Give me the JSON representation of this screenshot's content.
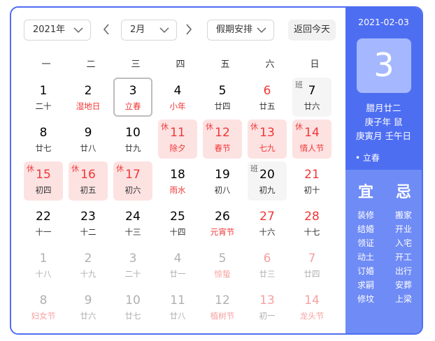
{
  "toolbar": {
    "year": "2021年",
    "month": "2月",
    "holiday": "假期安排",
    "today_button": "返回今天"
  },
  "weekdays": [
    "一",
    "二",
    "三",
    "四",
    "五",
    "六",
    "日"
  ],
  "days": [
    {
      "num": "1",
      "lunar": "二十"
    },
    {
      "num": "2",
      "lunar": "湿地日",
      "lunar_red": true
    },
    {
      "num": "3",
      "lunar": "立春",
      "lunar_red": true,
      "today": true
    },
    {
      "num": "4",
      "lunar": "小年",
      "lunar_red": true
    },
    {
      "num": "5",
      "lunar": "廿四"
    },
    {
      "num": "6",
      "lunar": "廿五",
      "num_red": true
    },
    {
      "num": "7",
      "lunar": "廿六",
      "tag": "班",
      "work": true
    },
    {
      "num": "8",
      "lunar": "廿七"
    },
    {
      "num": "9",
      "lunar": "廿八"
    },
    {
      "num": "10",
      "lunar": "廿九"
    },
    {
      "num": "11",
      "lunar": "除夕",
      "tag": "休",
      "rest": true,
      "num_red": true,
      "lunar_red": true
    },
    {
      "num": "12",
      "lunar": "春节",
      "tag": "休",
      "rest": true,
      "num_red": true,
      "lunar_red": true
    },
    {
      "num": "13",
      "lunar": "七九",
      "tag": "休",
      "rest": true,
      "num_red": true,
      "lunar_red": true
    },
    {
      "num": "14",
      "lunar": "情人节",
      "tag": "休",
      "rest": true,
      "num_red": true,
      "lunar_red": true
    },
    {
      "num": "15",
      "lunar": "初四",
      "tag": "休",
      "rest": true,
      "num_red": true
    },
    {
      "num": "16",
      "lunar": "初五",
      "tag": "休",
      "rest": true,
      "num_red": true
    },
    {
      "num": "17",
      "lunar": "初六",
      "tag": "休",
      "rest": true,
      "num_red": true
    },
    {
      "num": "18",
      "lunar": "雨水",
      "lunar_red": true
    },
    {
      "num": "19",
      "lunar": "初八"
    },
    {
      "num": "20",
      "lunar": "初九",
      "tag": "班",
      "work": true
    },
    {
      "num": "21",
      "lunar": "初十",
      "num_red": true
    },
    {
      "num": "22",
      "lunar": "十一"
    },
    {
      "num": "23",
      "lunar": "十二"
    },
    {
      "num": "24",
      "lunar": "十三"
    },
    {
      "num": "25",
      "lunar": "十四"
    },
    {
      "num": "26",
      "lunar": "元宵节",
      "lunar_red": true
    },
    {
      "num": "27",
      "lunar": "十六",
      "num_red": true
    },
    {
      "num": "28",
      "lunar": "十七",
      "num_red": true
    },
    {
      "num": "1",
      "lunar": "十八",
      "dim": true
    },
    {
      "num": "2",
      "lunar": "十九",
      "dim": true
    },
    {
      "num": "3",
      "lunar": "二十",
      "dim": true
    },
    {
      "num": "4",
      "lunar": "廿一",
      "dim": true
    },
    {
      "num": "5",
      "lunar": "惊蛰",
      "dim": true,
      "lunar_red": true
    },
    {
      "num": "6",
      "lunar": "廿三",
      "dim": true,
      "num_red": true
    },
    {
      "num": "7",
      "lunar": "廿四",
      "dim": true,
      "num_red": true
    },
    {
      "num": "8",
      "lunar": "妇女节",
      "dim": true,
      "lunar_red": true
    },
    {
      "num": "9",
      "lunar": "廿六",
      "dim": true
    },
    {
      "num": "10",
      "lunar": "廿七",
      "dim": true
    },
    {
      "num": "11",
      "lunar": "廿八",
      "dim": true
    },
    {
      "num": "12",
      "lunar": "植树节",
      "dim": true,
      "lunar_red": true
    },
    {
      "num": "13",
      "lunar": "初一",
      "dim": true,
      "num_red": true
    },
    {
      "num": "14",
      "lunar": "龙头节",
      "dim": true,
      "num_red": true,
      "lunar_red": true
    }
  ],
  "panel": {
    "date": "2021-02-03",
    "day": "3",
    "lunar_date": "腊月廿二",
    "year_ganzhi": "庚子年 鼠",
    "month_day_ganzhi": "庚寅月 壬午日",
    "solar_term": "• 立春",
    "yi_title": "宜",
    "ji_title": "忌",
    "yi": [
      "装修",
      "结婚",
      "领证",
      "动土",
      "订婚",
      "求嗣",
      "修坟"
    ],
    "ji": [
      "搬家",
      "开业",
      "入宅",
      "开工",
      "出行",
      "安葬",
      "上梁"
    ]
  },
  "colors": {
    "accent": "#4e6ef2",
    "holiday_red": "#f03737",
    "rest_bg": "#fde2e2"
  }
}
